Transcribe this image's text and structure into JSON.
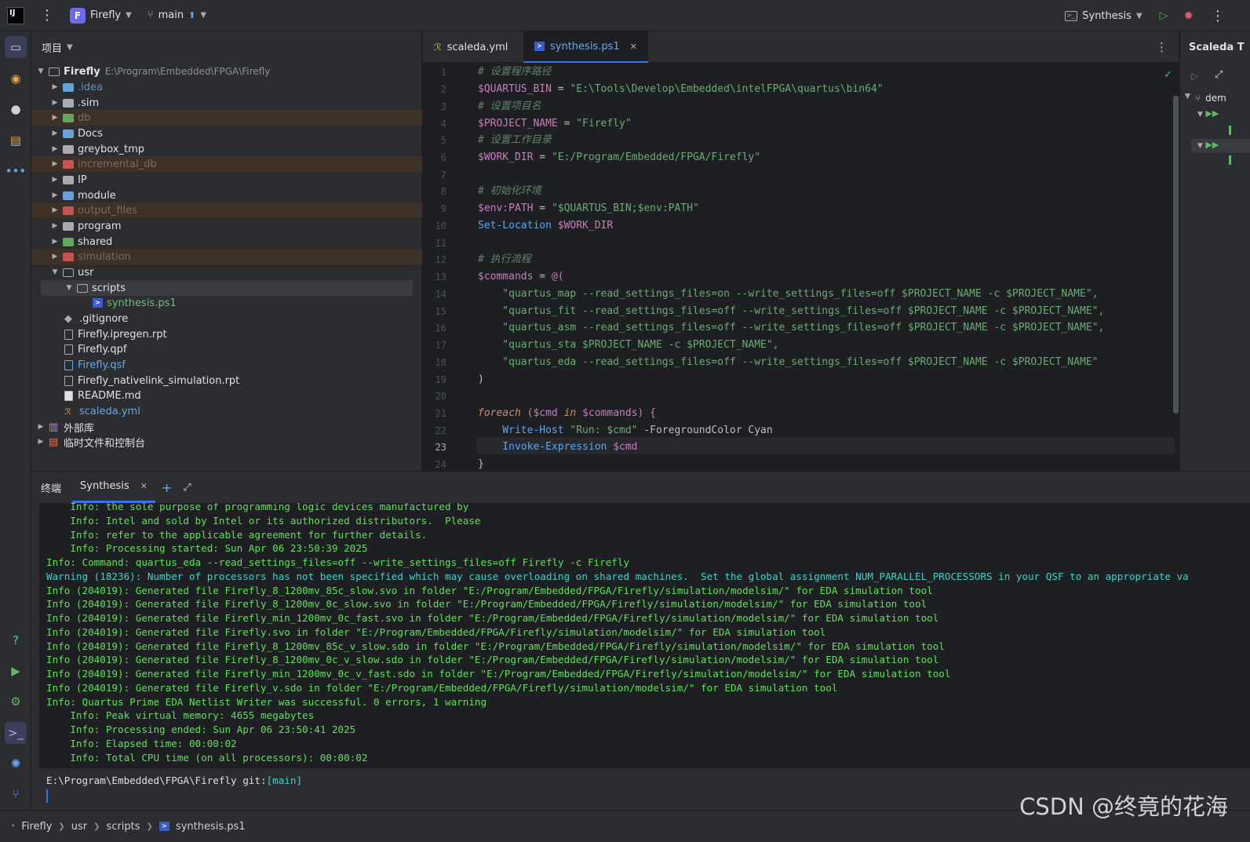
{
  "titlebar": {
    "project_badge": "F",
    "project_name": "Firefly",
    "branch": "main",
    "run_config": "Synthesis"
  },
  "project_panel": {
    "title": "项目",
    "root_name": "Firefly",
    "root_path": "E:\\Program\\Embedded\\FPGA\\Firefly",
    "items": [
      {
        "label": ".idea"
      },
      {
        "label": ".sim"
      },
      {
        "label": "db"
      },
      {
        "label": "Docs"
      },
      {
        "label": "greybox_tmp"
      },
      {
        "label": "incremental_db"
      },
      {
        "label": "IP"
      },
      {
        "label": "module"
      },
      {
        "label": "output_files"
      },
      {
        "label": "program"
      },
      {
        "label": "shared"
      },
      {
        "label": "simulation"
      },
      {
        "label": "usr"
      },
      {
        "label": "scripts"
      },
      {
        "label": "synthesis.ps1"
      },
      {
        "label": ".gitignore"
      },
      {
        "label": "Firefly.ipregen.rpt"
      },
      {
        "label": "Firefly.qpf"
      },
      {
        "label": "Firefly.qsf"
      },
      {
        "label": "Firefly_nativelink_simulation.rpt"
      },
      {
        "label": "README.md"
      },
      {
        "label": "scaleda.yml"
      },
      {
        "label": "外部库"
      },
      {
        "label": "临时文件和控制台"
      }
    ]
  },
  "editor": {
    "tabs": [
      {
        "label": "scaleda.yml"
      },
      {
        "label": "synthesis.ps1"
      }
    ],
    "line_numbers": [
      "1",
      "2",
      "3",
      "4",
      "5",
      "6",
      "7",
      "8",
      "9",
      "10",
      "11",
      "12",
      "13",
      "14",
      "15",
      "16",
      "17",
      "18",
      "19",
      "20",
      "21",
      "22",
      "23",
      "24"
    ],
    "code": {
      "l1": "# 设置程序路径",
      "l2a": "$QUARTUS_BIN",
      "l2b": " = ",
      "l2c": "\"E:\\Tools\\Develop\\Embedded\\intelFPGA\\quartus\\bin64\"",
      "l3": "# 设置项目名",
      "l4a": "$PROJECT_NAME",
      "l4b": " = ",
      "l4c": "\"Firefly\"",
      "l5": "# 设置工作目录",
      "l6a": "$WORK_DIR",
      "l6b": " = ",
      "l6c": "\"E:/Program/Embedded/FPGA/Firefly\"",
      "l8": "# 初始化环境",
      "l9a": "$env:PATH",
      "l9b": " = ",
      "l9c": "\"$QUARTUS_BIN;$env:PATH\"",
      "l10a": "Set-Location",
      "l10b": " $WORK_DIR",
      "l12": "# 执行流程",
      "l13a": "$commands",
      "l13b": " = ",
      "l13c": "@(",
      "l14": "    \"quartus_map --read_settings_files=on --write_settings_files=off $PROJECT_NAME -c $PROJECT_NAME\",",
      "l15": "    \"quartus_fit --read_settings_files=off --write_settings_files=off $PROJECT_NAME -c $PROJECT_NAME\",",
      "l16": "    \"quartus_asm --read_settings_files=off --write_settings_files=off $PROJECT_NAME -c $PROJECT_NAME\",",
      "l17": "    \"quartus_sta $PROJECT_NAME -c $PROJECT_NAME\",",
      "l18": "    \"quartus_eda --read_settings_files=off --write_settings_files=off $PROJECT_NAME -c $PROJECT_NAME\"",
      "l19": ")",
      "l21a": "foreach",
      "l21b": " ($cmd ",
      "l21c": "in",
      "l21d": " $commands) {",
      "l22a": "    Write-Host",
      "l22b": " \"Run: $cmd\"",
      "l22c": " -ForegroundColor Cyan",
      "l23a": "    Invoke-Expression",
      "l23b": " $cmd",
      "l24": "}"
    }
  },
  "right_panel": {
    "title": "Scaleda T",
    "item": "dem"
  },
  "terminal": {
    "tab_label": "终端",
    "session_tab": "Synthesis",
    "lines": [
      "    Info: the sole purpose of programming logic devices manufactured by",
      "    Info: Intel and sold by Intel or its authorized distributors.  Please",
      "    Info: refer to the applicable agreement for further details.",
      "    Info: Processing started: Sun Apr 06 23:50:39 2025",
      "Info: Command: quartus_eda --read_settings_files=off --write_settings_files=off Firefly -c Firefly",
      "Warning (18236): Number of processors has not been specified which may cause overloading on shared machines.  Set the global assignment NUM_PARALLEL_PROCESSORS in your QSF to an appropriate va",
      "Info (204019): Generated file Firefly_8_1200mv_85c_slow.svo in folder \"E:/Program/Embedded/FPGA/Firefly/simulation/modelsim/\" for EDA simulation tool",
      "Info (204019): Generated file Firefly_8_1200mv_0c_slow.svo in folder \"E:/Program/Embedded/FPGA/Firefly/simulation/modelsim/\" for EDA simulation tool",
      "Info (204019): Generated file Firefly_min_1200mv_0c_fast.svo in folder \"E:/Program/Embedded/FPGA/Firefly/simulation/modelsim/\" for EDA simulation tool",
      "Info (204019): Generated file Firefly.svo in folder \"E:/Program/Embedded/FPGA/Firefly/simulation/modelsim/\" for EDA simulation tool",
      "Info (204019): Generated file Firefly_8_1200mv_85c_v_slow.sdo in folder \"E:/Program/Embedded/FPGA/Firefly/simulation/modelsim/\" for EDA simulation tool",
      "Info (204019): Generated file Firefly_8_1200mv_0c_v_slow.sdo in folder \"E:/Program/Embedded/FPGA/Firefly/simulation/modelsim/\" for EDA simulation tool",
      "Info (204019): Generated file Firefly_min_1200mv_0c_v_fast.sdo in folder \"E:/Program/Embedded/FPGA/Firefly/simulation/modelsim/\" for EDA simulation tool",
      "Info (204019): Generated file Firefly_v.sdo in folder \"E:/Program/Embedded/FPGA/Firefly/simulation/modelsim/\" for EDA simulation tool",
      "Info: Quartus Prime EDA Netlist Writer was successful. 0 errors, 1 warning",
      "    Info: Peak virtual memory: 4655 megabytes",
      "    Info: Processing ended: Sun Apr 06 23:50:41 2025",
      "    Info: Elapsed time: 00:00:02",
      "    Info: Total CPU time (on all processors): 00:00:02"
    ],
    "prompt_path": "E:\\Program\\Embedded\\FPGA\\Firefly ",
    "prompt_git": "git:",
    "prompt_branch": "[main]"
  },
  "statusbar": {
    "crumbs": [
      "Firefly",
      "usr",
      "scripts",
      "synthesis.ps1"
    ]
  },
  "watermark": "CSDN @终竟的花海"
}
